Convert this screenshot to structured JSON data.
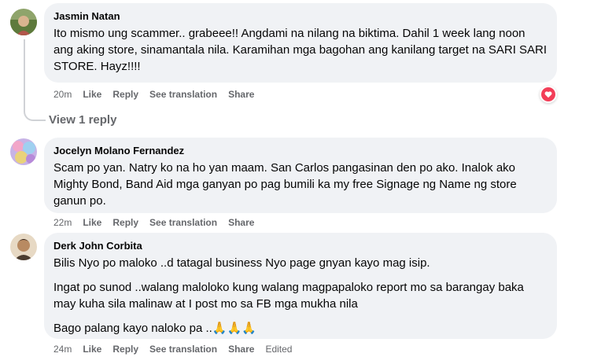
{
  "comments": [
    {
      "author": "Jasmin Natan",
      "lines": [
        "Ito mismo ung scammer.. grabeee!! Angdami na nilang na biktima. Dahil 1 week lang noon ang aking store, sinamantala nila. Karamihan mga bagohan ang kanilang target na SARI SARI STORE. Hayz!!!!"
      ],
      "time": "20m",
      "like": "Like",
      "reply": "Reply",
      "translate": "See translation",
      "share": "Share",
      "reaction_icon": "heart-icon"
    },
    {
      "author": "Jocelyn Molano Fernandez",
      "lines": [
        "Scam po yan. Natry ko na ho yan maam. San Carlos pangasinan den po ako. Inalok ako Mighty Bond, Band Aid mga ganyan po pag bumili ka my free Signage ng Name ng store ganun po."
      ],
      "time": "22m",
      "like": "Like",
      "reply": "Reply",
      "translate": "See translation",
      "share": "Share"
    },
    {
      "author": "Derk John Corbita",
      "lines": [
        "Bilis Nyo po maloko ..d tatagal business Nyo page gnyan kayo mag isip.",
        "Ingat po sunod ..walang maloloko kung walang magpapaloko report mo sa barangay baka may kuha sila malinaw at I post mo sa FB mga mukha nila",
        "Bago palang kayo naloko pa ..🙏🙏🙏"
      ],
      "time": "24m",
      "like": "Like",
      "reply": "Reply",
      "translate": "See translation",
      "share": "Share",
      "edited": "Edited"
    }
  ],
  "view_replies": "View 1 reply",
  "colors": {
    "bubble": "#f0f2f5",
    "meta": "#65676b",
    "heart": "#f33e58"
  }
}
